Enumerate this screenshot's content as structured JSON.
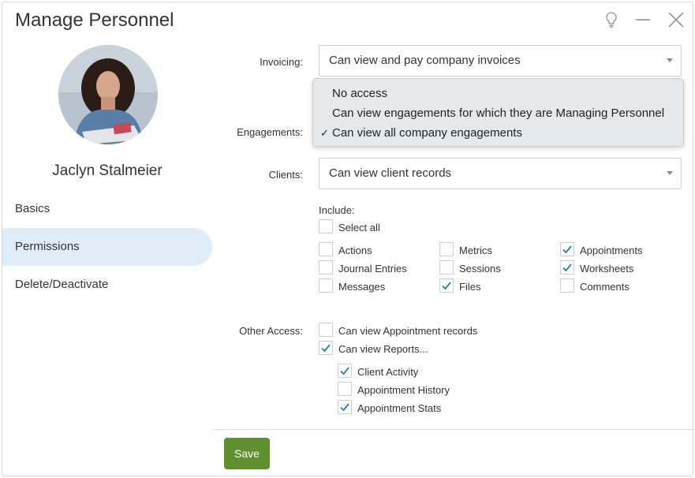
{
  "window": {
    "title": "Manage Personnel",
    "controls": [
      "lightbulb-icon",
      "minimize-icon",
      "close-icon"
    ]
  },
  "profile": {
    "name": "Jaclyn Stalmeier"
  },
  "sidebar": {
    "items": [
      {
        "label": "Basics",
        "active": false
      },
      {
        "label": "Permissions",
        "active": true
      },
      {
        "label": "Delete/Deactivate",
        "active": false
      }
    ]
  },
  "permissions": {
    "invoicing": {
      "label": "Invoicing:",
      "value": "Can view and pay company invoices"
    },
    "engagements": {
      "label": "Engagements:",
      "options": [
        "No access",
        "Can view engagements for which they are Managing Personnel",
        "Can view all company engagements"
      ],
      "selected_check": "✓"
    },
    "clients": {
      "label": "Clients:",
      "value": "Can view client records"
    },
    "include": {
      "label": "Include:",
      "select_all": {
        "label": "Select all",
        "checked": false
      },
      "items": [
        {
          "label": "Actions",
          "checked": false
        },
        {
          "label": "Journal Entries",
          "checked": false
        },
        {
          "label": "Messages",
          "checked": false
        },
        {
          "label": "Metrics",
          "checked": false
        },
        {
          "label": "Sessions",
          "checked": false
        },
        {
          "label": "Files",
          "checked": true
        },
        {
          "label": "Appointments",
          "checked": true
        },
        {
          "label": "Worksheets",
          "checked": true
        },
        {
          "label": "Comments",
          "checked": false
        }
      ]
    },
    "other_access": {
      "label": "Other Access:",
      "items": [
        {
          "label": "Can view Appointment records",
          "checked": false
        },
        {
          "label": "Can view Reports...",
          "checked": true
        }
      ],
      "reports": [
        {
          "label": "Client Activity",
          "checked": true
        },
        {
          "label": "Appointment History",
          "checked": false
        },
        {
          "label": "Appointment Stats",
          "checked": true
        }
      ]
    }
  },
  "footer": {
    "save_label": "Save"
  },
  "colors": {
    "accent": "#5f8f2e",
    "nav_active_bg": "#deedf8",
    "check_color": "#2a7ab8"
  }
}
